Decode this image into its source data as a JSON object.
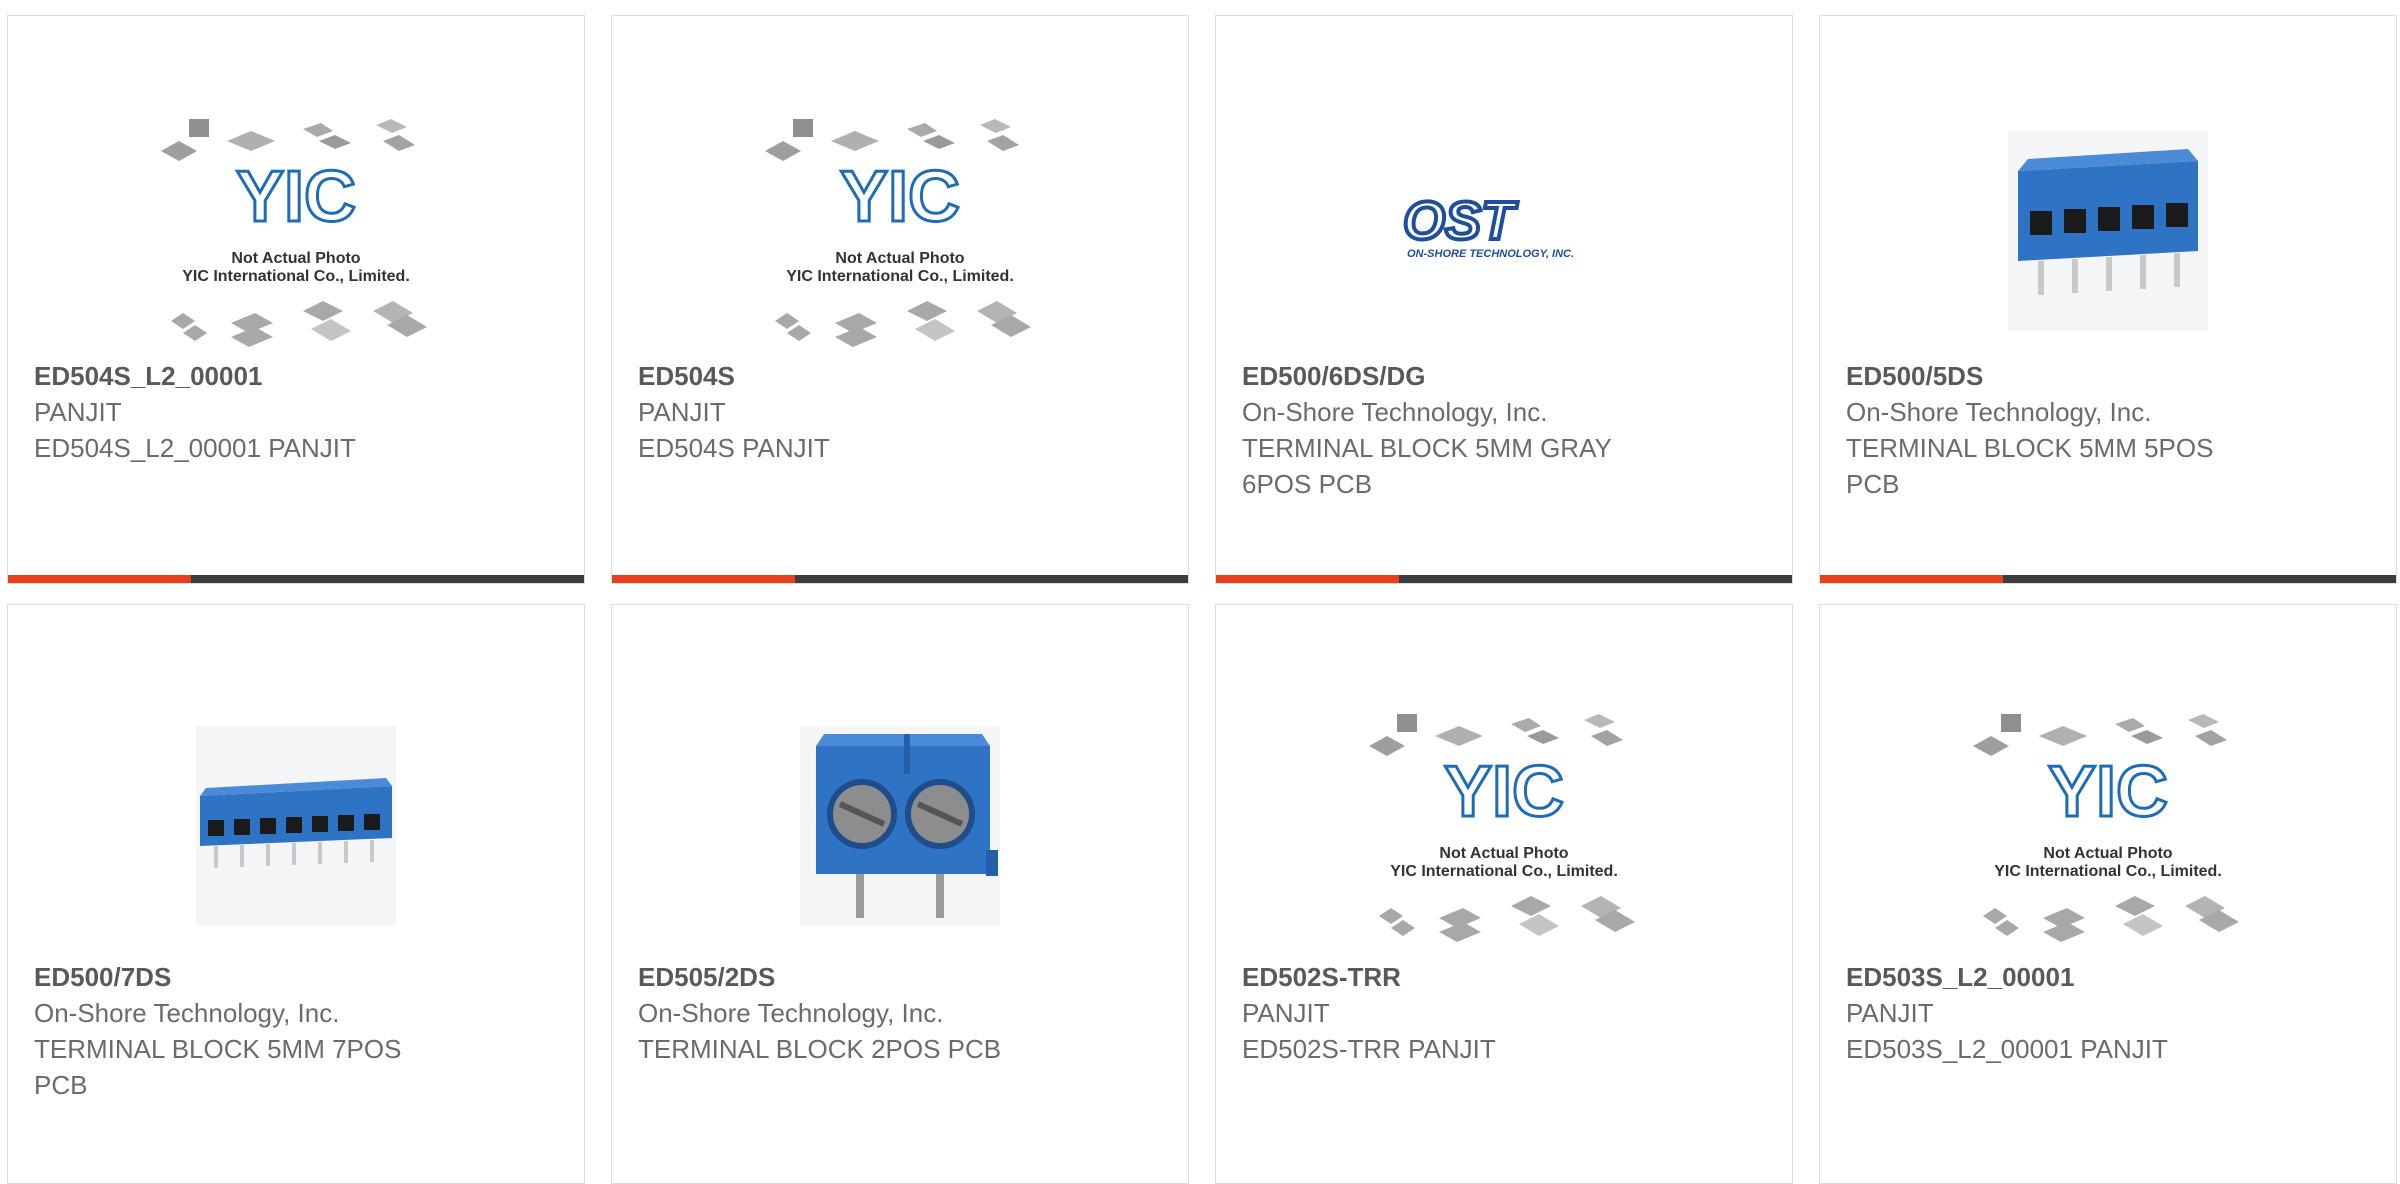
{
  "products": [
    {
      "part": "ED504S_L2_00001",
      "maker": "PANJIT",
      "desc": "ED504S_L2_00001 PANJIT",
      "image": "yic-placeholder"
    },
    {
      "part": "ED504S",
      "maker": "PANJIT",
      "desc": "ED504S PANJIT",
      "image": "yic-placeholder"
    },
    {
      "part": "ED500/6DS/DG",
      "maker": "On-Shore Technology, Inc.",
      "desc": "TERMINAL BLOCK 5MM GRAY 6POS PCB",
      "image": "ost-logo"
    },
    {
      "part": "ED500/5DS",
      "maker": "On-Shore Technology, Inc.",
      "desc": "TERMINAL BLOCK 5MM 5POS PCB",
      "image": "terminal-block-5"
    },
    {
      "part": "ED500/7DS",
      "maker": "On-Shore Technology, Inc.",
      "desc": "TERMINAL BLOCK 5MM 7POS PCB",
      "image": "terminal-block-7"
    },
    {
      "part": "ED505/2DS",
      "maker": "On-Shore Technology, Inc.",
      "desc": "TERMINAL BLOCK 2POS PCB",
      "image": "terminal-block-2"
    },
    {
      "part": "ED502S-TRR",
      "maker": "PANJIT",
      "desc": "ED502S-TRR PANJIT",
      "image": "yic-placeholder"
    },
    {
      "part": "ED503S_L2_00001",
      "maker": "PANJIT",
      "desc": "ED503S_L2_00001 PANJIT",
      "image": "yic-placeholder"
    }
  ],
  "placeholder": {
    "brand": "YIC",
    "line1": "Not Actual Photo",
    "line2": "YIC International Co., Limited."
  },
  "ost_logo": {
    "mark": "OST",
    "name": "ON-SHORE TECHNOLOGY, INC."
  },
  "colors": {
    "accent": "#e8401c",
    "bar": "#3d3d3d",
    "block_blue": "#2f73c4",
    "ost_blue": "#1f4e9c"
  }
}
